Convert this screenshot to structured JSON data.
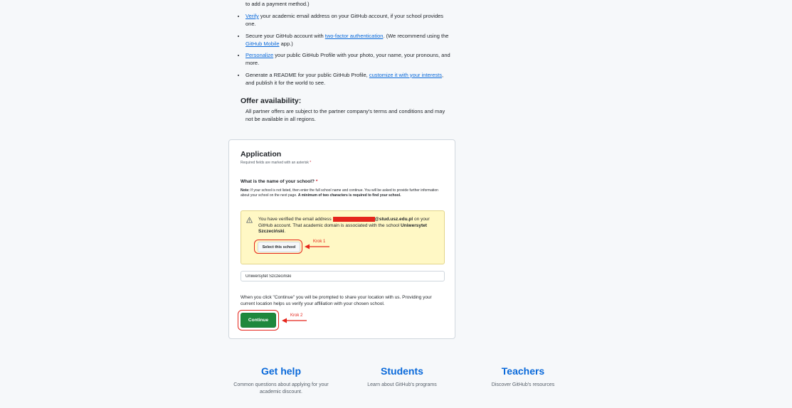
{
  "intro": {
    "cut_line": "to add a payment method.)",
    "bullets": [
      {
        "link": "Verify",
        "text": " your academic email address on your GitHub account, if your school provides one."
      },
      {
        "pre": "Secure your GitHub account with ",
        "link": "two-factor authentication",
        "mid": ". (We recommend using the ",
        "link2": "GitHub Mobile",
        "post": " app.)"
      },
      {
        "link": "Personalize",
        "text": " your public GitHub Profile with your photo, your name, your pronouns, and more."
      },
      {
        "pre": "Generate a README for your public GitHub Profile, ",
        "link": "customize it with your interests",
        "post": ", and publish it for the world to see."
      }
    ]
  },
  "offer": {
    "title": "Offer availability:",
    "text": "All partner offers are subject to the partner company's terms and conditions and may not be available in all regions."
  },
  "application": {
    "title": "Application",
    "required_note": "Required fields are marked with an asterisk",
    "asterisk": "*",
    "question": "What is the name of your school?",
    "note_label": "Note:",
    "note_text": " If your school is not listed, then enter the full school name and continue. You will be asked to provide further information about your school on the next page. ",
    "note_bold": "A minimum of two characters is required to find your school.",
    "warning_pre": "You have verified the email address ",
    "warning_domain": "@stud.usz.edu.pl",
    "warning_mid": " on your GitHub account. That academic domain is associated with the school ",
    "warning_school": "Uniwersytet Szczeciński",
    "warning_end": ".",
    "select_button": "Select this school",
    "school_value": "Uniwersytet Szczeciński",
    "continue_note": "When you click \"Continue\" you will be prompted to share your location with us. Providing your current location helps us verify your affiliation with your chosen school.",
    "continue_button": "Continue",
    "annotation1": "Krok 1",
    "annotation2": "Krok 2",
    "accent_red": "#e5251b",
    "accent_green": "#1f883d"
  },
  "footer": {
    "help_title": "Get help",
    "help_text": "Common questions about applying for your academic discount.",
    "students_title": "Students",
    "students_text": "Learn about GitHub's programs",
    "teachers_title": "Teachers",
    "teachers_text": "Discover GitHub's resources"
  }
}
